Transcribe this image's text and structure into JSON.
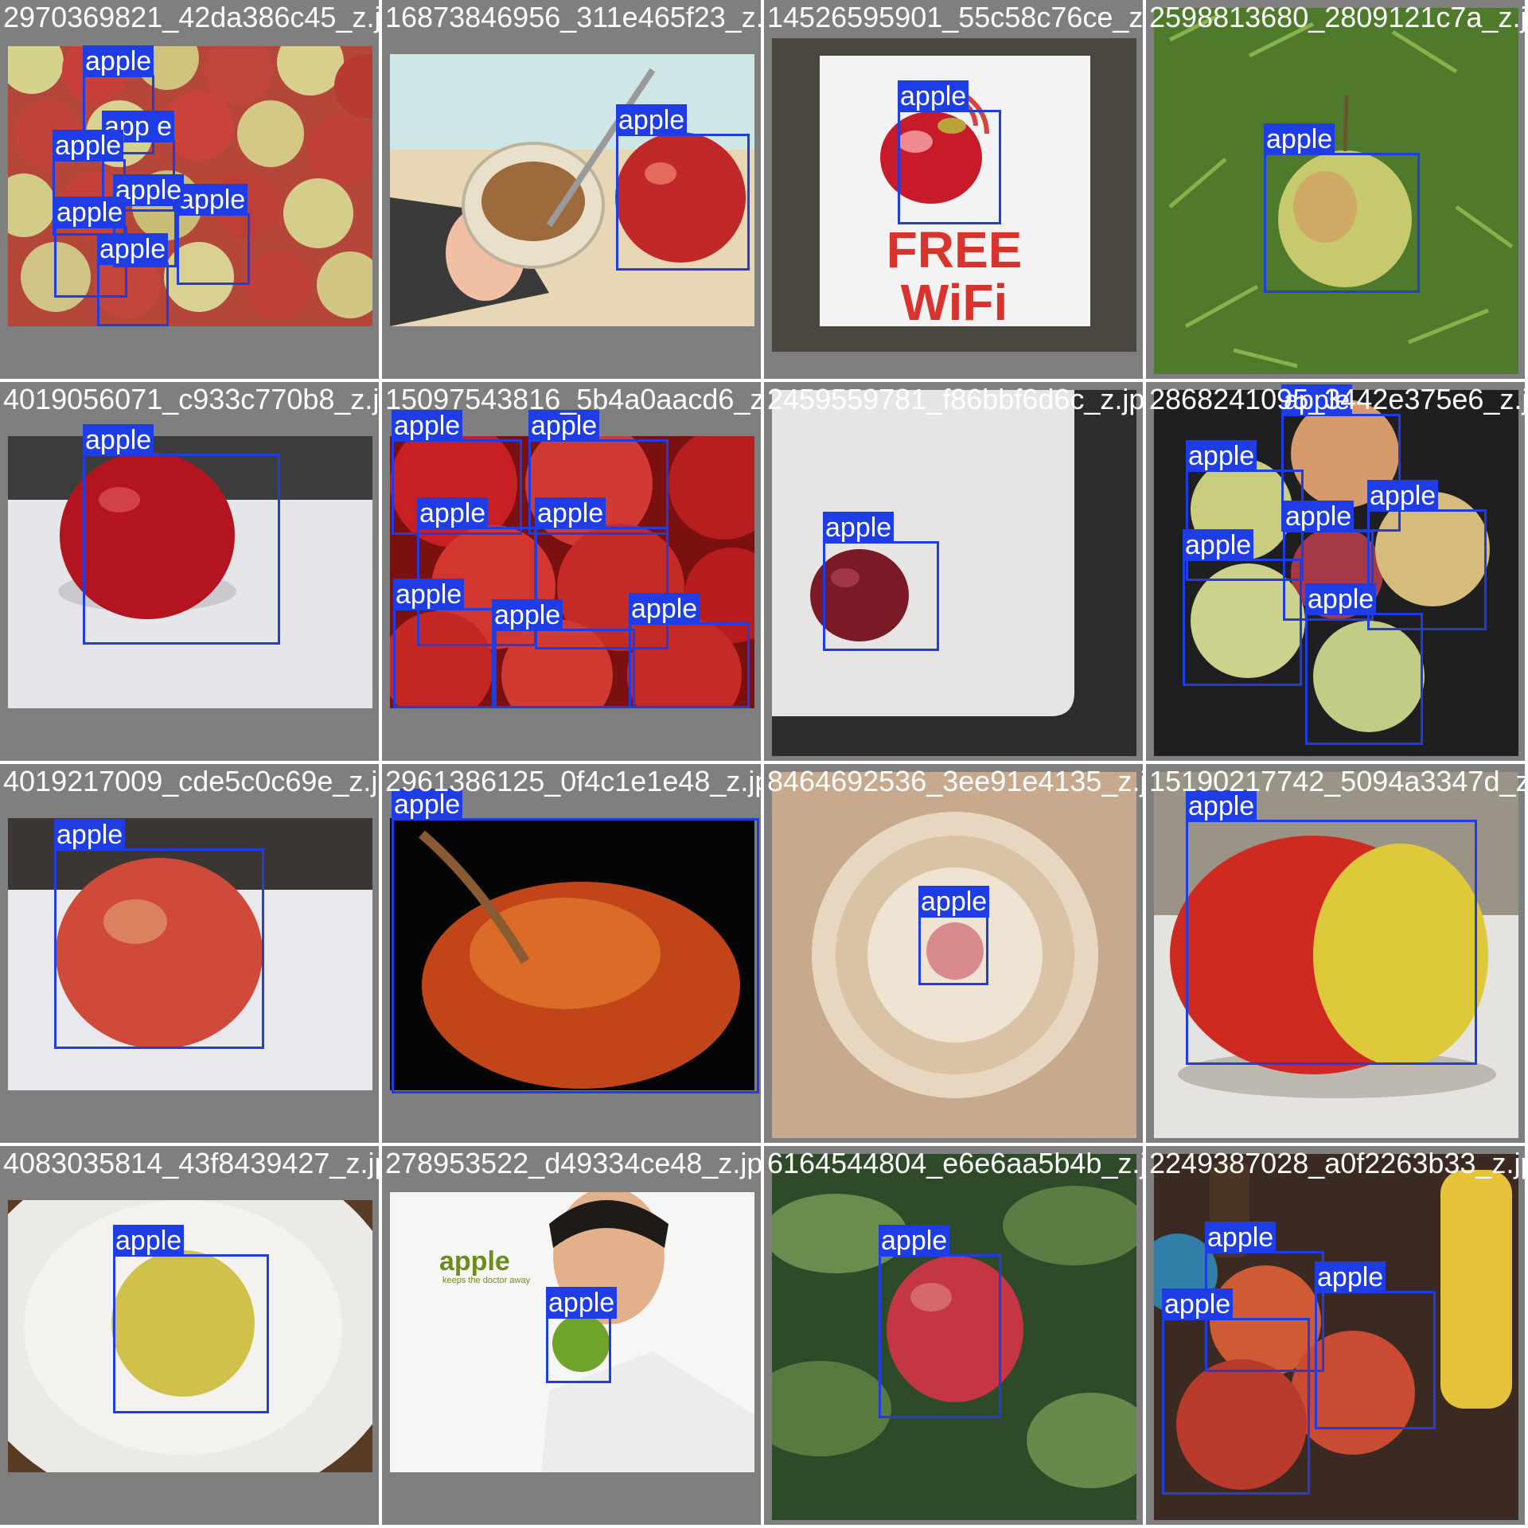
{
  "tiles": [
    {
      "filename": "2970369821_42da386c45_z.jpg",
      "scene": "pile",
      "labels": [
        "apple",
        "app e",
        "apple",
        "apple",
        "apple",
        "apple",
        "apple"
      ]
    },
    {
      "filename": "16873846956_311e465f23_z.jpg",
      "scene": "granola",
      "labels": [
        "apple"
      ]
    },
    {
      "filename": "14526595901_55c58c76ce_z.jpg",
      "scene": "wifi",
      "sign_text": [
        "FREE",
        "WiFi"
      ],
      "labels": [
        "apple"
      ]
    },
    {
      "filename": "2598813680_2809121c7a_z.jpg",
      "scene": "grass",
      "labels": [
        "apple"
      ]
    },
    {
      "filename": "4019056071_c933c770b8_z.jpg",
      "scene": "red-white",
      "labels": [
        "apple"
      ]
    },
    {
      "filename": "15097543816_5b4a0aacd6_z.jpg",
      "scene": "crate",
      "labels": [
        "apple",
        "apple",
        "apple",
        "apple",
        "apple",
        "apple",
        "apple"
      ]
    },
    {
      "filename": "2459559781_f86bbf6d6c_z.jpg",
      "scene": "table",
      "labels": [
        "apple"
      ]
    },
    {
      "filename": "2868241095_3442e375e6_z.jpg",
      "scene": "dark",
      "labels": [
        "apple",
        "apple",
        "apple",
        "apple",
        "apple",
        "apple"
      ]
    },
    {
      "filename": "4019217009_cde5c0c69e_z.jpg",
      "scene": "gala",
      "labels": [
        "apple"
      ]
    },
    {
      "filename": "2961386125_0f4c1e1e48_z.jpg",
      "scene": "drops",
      "labels": [
        "apple"
      ]
    },
    {
      "filename": "8464692536_3ee91e4135_z.jpg",
      "scene": "bowl",
      "labels": [
        "apple"
      ]
    },
    {
      "filename": "15190217742_5094a3347d_z.jpg",
      "scene": "bicolor",
      "labels": [
        "apple"
      ]
    },
    {
      "filename": "4083035814_43f8439427_z.jpg",
      "scene": "plate",
      "labels": [
        "apple"
      ]
    },
    {
      "filename": "278953522_d49334ce48_z.jpg",
      "scene": "man",
      "logo_text": "apple",
      "logo_sub": "keeps the doctor away",
      "labels": [
        "apple"
      ]
    },
    {
      "filename": "6164544804_e6e6aa5b4b_z.jpg",
      "scene": "tree",
      "labels": [
        "apple"
      ]
    },
    {
      "filename": "2249387028_a0f2263b33_z.jpg",
      "scene": "drinks",
      "labels": [
        "apple",
        "apple",
        "apple"
      ]
    }
  ],
  "colors": {
    "box": "#1f3de6",
    "tile_bg": "#7f7f7f",
    "text": "#ffffff"
  }
}
